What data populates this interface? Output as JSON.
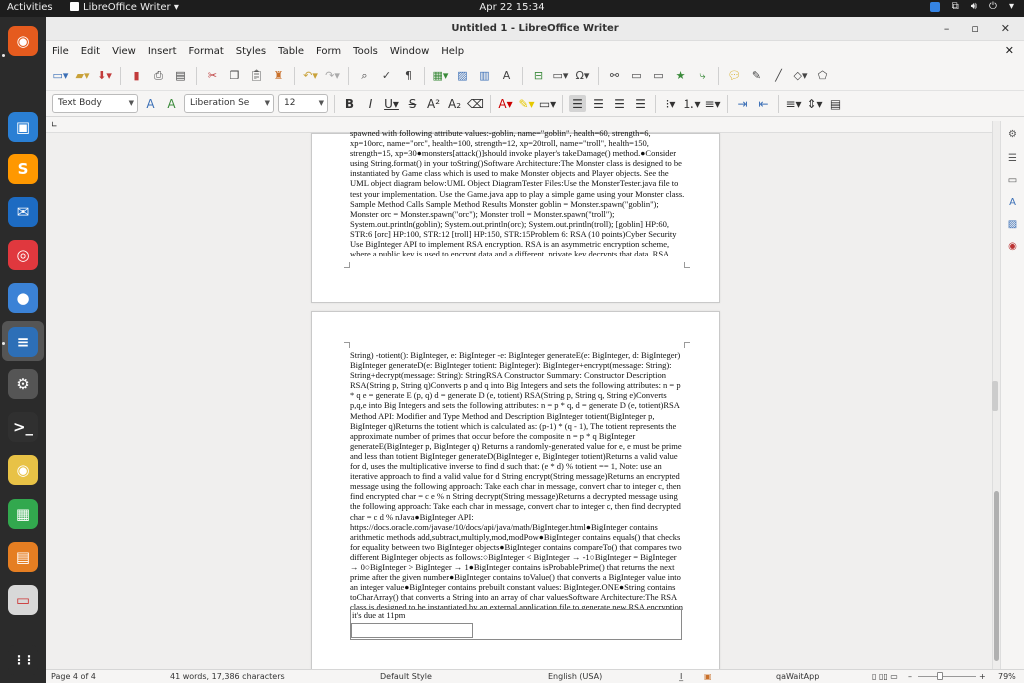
{
  "topbar": {
    "activities": "Activities",
    "app_name": "LibreOffice Writer",
    "datetime": "Apr 22  15:34"
  },
  "dock": {
    "items": [
      {
        "name": "firefox-icon",
        "color": "#e55b1e",
        "glyph": "◉"
      },
      {
        "name": "software-center-icon",
        "color": "#2a7fd4",
        "glyph": "▣"
      },
      {
        "name": "sublime-text-icon",
        "color": "#ff9800",
        "glyph": "S"
      },
      {
        "name": "thunderbird-icon",
        "color": "#1d6bc2",
        "glyph": "✉"
      },
      {
        "name": "help-lifebuoy-icon",
        "color": "#e0383e",
        "glyph": "◎"
      },
      {
        "name": "chromium-icon",
        "color": "#3b82d6",
        "glyph": "●"
      },
      {
        "name": "writer-icon",
        "color": "#2d6fb7",
        "glyph": "≡"
      },
      {
        "name": "settings-gear-icon",
        "color": "#555555",
        "glyph": "⚙"
      },
      {
        "name": "terminal-icon",
        "color": "#303030",
        "glyph": ">_"
      },
      {
        "name": "rhythmbox-icon",
        "color": "#e8c246",
        "glyph": "◉"
      },
      {
        "name": "calc-icon",
        "color": "#32a84e",
        "glyph": "▦"
      },
      {
        "name": "impress-icon",
        "color": "#e57e22",
        "glyph": "▤"
      },
      {
        "name": "document-viewer-icon",
        "color": "#d8d8d8",
        "glyph": "▭"
      },
      {
        "name": "show-apps-grid-icon",
        "color": "#2b2b2b",
        "glyph": "⋮⋮"
      }
    ]
  },
  "window": {
    "title": "Untitled 1 - LibreOffice Writer"
  },
  "menu": [
    "File",
    "Edit",
    "View",
    "Insert",
    "Format",
    "Styles",
    "Table",
    "Form",
    "Tools",
    "Window",
    "Help"
  ],
  "formatting": {
    "paragraph_style": "Text Body",
    "font_name": "Liberation Se",
    "font_size": "12"
  },
  "document": {
    "page1_text": "spawned with following attribute values:-goblin, name=\"goblin\", health=60, strength=6, xp=10orc, name=\"orc\", health=100, strength=12, xp=20troll, name=\"troll\", health=150, strength=15, xp=30●monsters[attack()]should invoke player's takeDamage() method.●Consider using String.format() in your toString()Software Architecture:The Monster class is designed to be instantiated by Game class which is used to make Monster objects and Player objects. See the UML object diagram below:UML Object DiagramTester Files:Use the MonsterTester.java file to test your implementation. Use the Game.java app to play a simple game using your Monster class. Sample Method Calls Sample Method Results Monster goblin = Monster.spawn(\"goblin\"); Monster orc = Monster.spawn(\"orc\"); Monster troll = Monster.spawn(\"troll\"); System.out.println(goblin); System.out.println(orc); System.out.println(troll); [goblin] HP:60, STR:6 [orc] HP:100, STR:12 [troll] HP:150, STR:15Problem 6: RSA (10 points)Cyber Security Use BigInteger API to implement RSA encryption. RSA is an asymmetric encryption scheme, where a public key is used to encrypt data and a different, private key decrypts that data. RSA public/private keys are generated from two prime numbers, typically very large ones. UML Class Diagram:RSA -p: BigInteger -q: BigInteger -d: BigInteger+constructor(p: String, q:",
    "page2_text": "String) -totient(): BigInteger, e: BigInteger -e: BigInteger generateE(e: BigInteger, d: BigInteger) BigInteger generateD(e: BigInteger totient: BigInteger): BigInteger+encrypt(message: String): String+decrypt(message: String): StringRSA Constructor Summary: Constructor Description RSA(String p, String q)Converts p and q into Big Integers and sets the following attributes: n = p * q e = generate E (p, q) d = generate D (e, totient) RSA(String p, String q, String e)Converts p,q,e into Big Integers and sets the following attributes: n = p * q, d = generate D (e, totient)RSA Method API: Modifier and Type Method and Description BigInteger totient(BigInteger p, BigInteger q)Returns the totient which is calculated as: (p-1) * (q - 1), The totient represents the approximate number of primes that occur before the composite n = p * q BigInteger generateE(BigInteger p, BigInteger q) Returns a randomly-generated value for e, e must be prime and less than totient BigInteger generateD(BigInteger e, BigInteger totient)Returns a valid value for d, uses the multiplicative inverse to find d such that: (e * d) % totient == 1, Note: use an iterative approach to find a valid value for d String encrypt(String message)Returns an encrypted message using the following approach: Take each char in message, convert char to integer c, then find encrypted char = c e % n String decrypt(String message)Returns a decrypted message using the following approach: Take each char in message, convert char to integer c, then find decrypted char = c d % nJava●BigInteger API: https://docs.oracle.com/javase/10/docs/api/java/math/BigInteger.html●BigInteger contains arithmetic methods add,subtract,multiply,mod,modPow●BigInteger contains equals() that checks for equality between two BigInteger objects●BigInteger contains compareTo() that compares two different BigInteger objects as follows:○BigInteger < BigInteger → -1○BigInteger = BigInteger → 0○BigInteger > BigInteger → 1●BigInteger contains isProbablePrime() that returns the next prime after the given number●BigInteger contains toValue() that converts a BigInteger value into an integer value●BigInteger contains prebuilt constant values: BigInteger.ONE●String contains toCharArray() that converts a String into an array of char valuesSoftware Architecture:The RSA class is designed to be instantiated by an external application file to generate new RSA encryption keys.Tester Files:Use the RSATester.java file to test your implementation. Sample Method Calls Sample Method Results RSA rsa = new RSA(\"19\",\"79\", \"17\"); String message = \"Hello World\"; message = rsa.encrypt(message); message = rsa.decrypt(message);7I9j■ 7S9 Hello World",
    "frame_text": "it's due at 11pm"
  },
  "status": {
    "page": "Page 4 of 4",
    "words": "41 words, 17,386 characters",
    "page_style": "Default Style",
    "language": "English (USA)",
    "signature": "qaWaitApp",
    "zoom": "79%"
  }
}
